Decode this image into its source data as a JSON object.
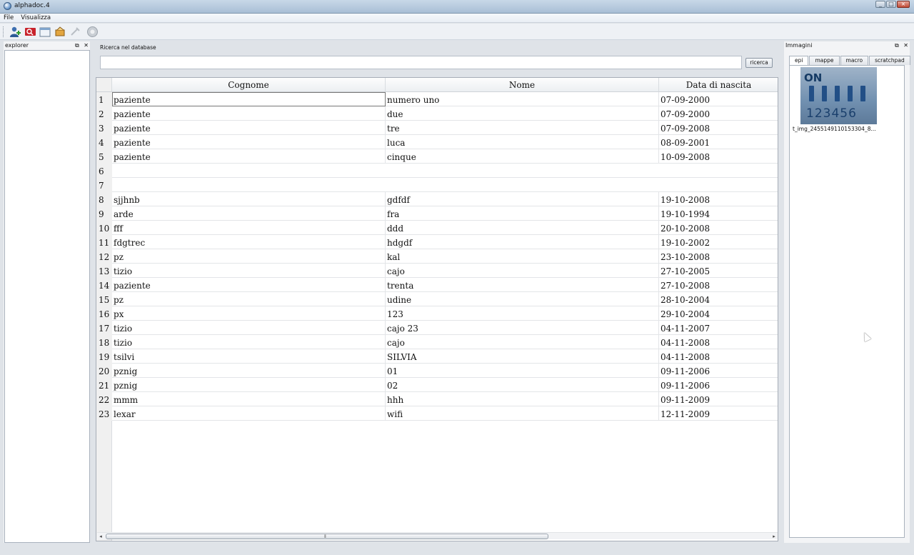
{
  "window": {
    "title": "alphadoc.4",
    "buttons": [
      "_",
      "□",
      "×"
    ]
  },
  "menubar": [
    "File",
    "Visualizza"
  ],
  "toolbar": {
    "icons": [
      "add-patient-icon",
      "search-patient-icon",
      "window-icon",
      "edit-icon",
      "disabled-tool-icon",
      "stop-icon"
    ]
  },
  "explorer": {
    "title": "explorer",
    "float": "⧉",
    "close": "✕"
  },
  "search": {
    "label": "Ricerca nel database",
    "value": "",
    "button": "ricerca"
  },
  "table": {
    "headers": [
      "Cognome",
      "Nome",
      "Data di nascita"
    ],
    "rows": [
      {
        "n": "1",
        "cognome": "paziente",
        "nome": "numero uno",
        "data": "07-09-2000"
      },
      {
        "n": "2",
        "cognome": "paziente",
        "nome": "due",
        "data": "07-09-2000"
      },
      {
        "n": "3",
        "cognome": "paziente",
        "nome": "tre",
        "data": "07-09-2008"
      },
      {
        "n": "4",
        "cognome": "paziente",
        "nome": "luca",
        "data": "08-09-2001"
      },
      {
        "n": "5",
        "cognome": "paziente",
        "nome": "cinque",
        "data": "10-09-2008"
      },
      {
        "n": "6",
        "cognome": "",
        "nome": "",
        "data": ""
      },
      {
        "n": "7",
        "cognome": "",
        "nome": "",
        "data": ""
      },
      {
        "n": "8",
        "cognome": "sjjhnb",
        "nome": "gdfdf",
        "data": "19-10-2008"
      },
      {
        "n": "9",
        "cognome": "arde",
        "nome": "fra",
        "data": "19-10-1994"
      },
      {
        "n": "10",
        "cognome": "fff",
        "nome": "ddd",
        "data": "20-10-2008"
      },
      {
        "n": "11",
        "cognome": "fdgtrec",
        "nome": "hdgdf",
        "data": "19-10-2002"
      },
      {
        "n": "12",
        "cognome": "pz",
        "nome": "kal",
        "data": "23-10-2008"
      },
      {
        "n": "13",
        "cognome": "tizio",
        "nome": "cajo",
        "data": "27-10-2005"
      },
      {
        "n": "14",
        "cognome": "paziente",
        "nome": "trenta",
        "data": "27-10-2008"
      },
      {
        "n": "15",
        "cognome": "pz",
        "nome": "udine",
        "data": "28-10-2004"
      },
      {
        "n": "16",
        "cognome": "px",
        "nome": "123",
        "data": "29-10-2004"
      },
      {
        "n": "17",
        "cognome": "tizio",
        "nome": "cajo 23",
        "data": "04-11-2007"
      },
      {
        "n": "18",
        "cognome": "tizio",
        "nome": "cajo",
        "data": "04-11-2008"
      },
      {
        "n": "19",
        "cognome": "tsilvi",
        "nome": "SILVIA",
        "data": "04-11-2008"
      },
      {
        "n": "20",
        "cognome": "pznig",
        "nome": "01",
        "data": "09-11-2006"
      },
      {
        "n": "21",
        "cognome": "pznig",
        "nome": "02",
        "data": "09-11-2006"
      },
      {
        "n": "22",
        "cognome": "mmm",
        "nome": "hhh",
        "data": "09-11-2009"
      },
      {
        "n": "23",
        "cognome": "lexar",
        "nome": "wifi",
        "data": "12-11-2009"
      }
    ],
    "scrollbar": {
      "left": "◂",
      "right": "▸",
      "grip": "⦀"
    }
  },
  "images": {
    "title": "Immagini",
    "float": "⧉",
    "close": "✕",
    "tabs": [
      "epi",
      "mappe",
      "macro",
      "scratchpad"
    ],
    "active_tab": "epi",
    "thumbnail": {
      "on_text": "ON",
      "digits": "123456",
      "caption": "t_img_2455149110153304_8..."
    }
  }
}
